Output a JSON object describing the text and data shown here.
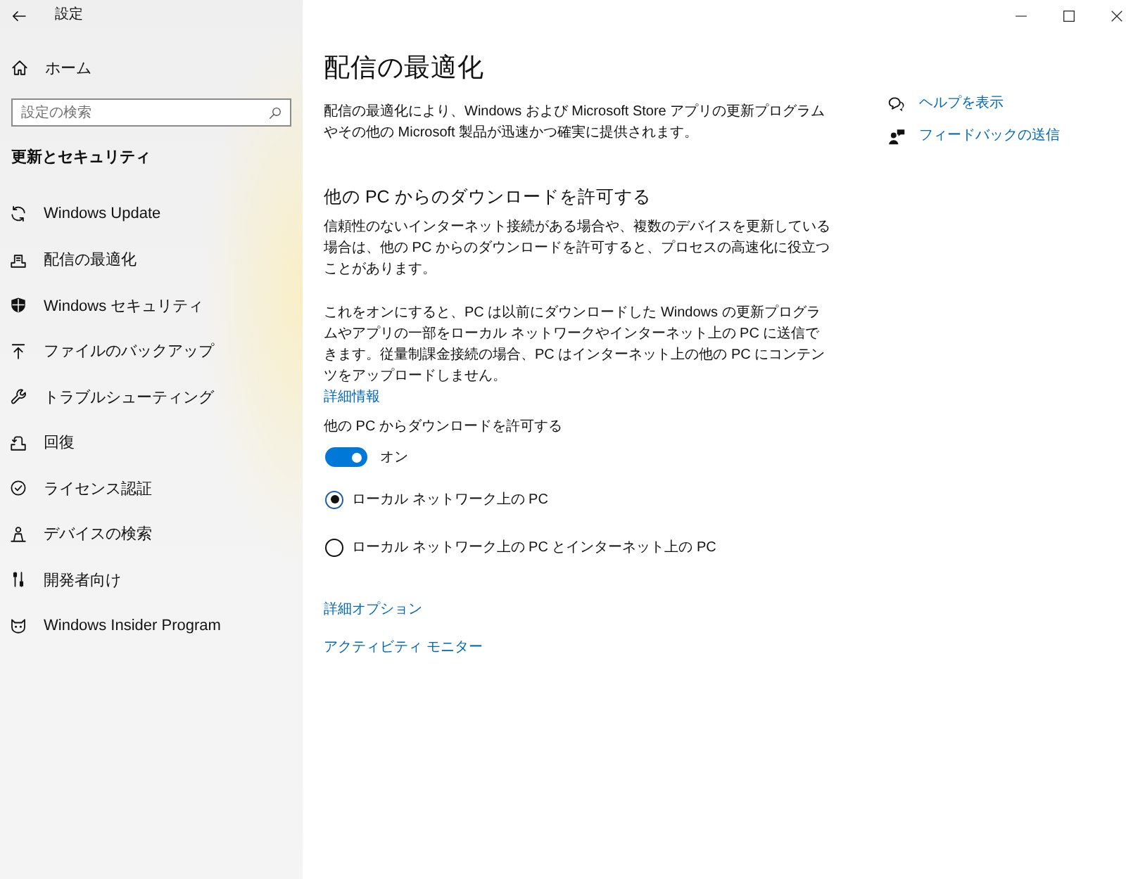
{
  "window": {
    "title": "設定"
  },
  "sidebar": {
    "home": "ホーム",
    "search": {
      "placeholder": "設定の検索"
    },
    "section": "更新とセキュリティ",
    "items": [
      "Windows Update",
      "配信の最適化",
      "Windows セキュリティ",
      "ファイルのバックアップ",
      "トラブルシューティング",
      "回復",
      "ライセンス認証",
      "デバイスの検索",
      "開発者向け",
      "Windows Insider Program"
    ]
  },
  "content": {
    "title": "配信の最適化",
    "intro": "配信の最適化により、Windows および Microsoft Store アプリの更新プログラムやその他の Microsoft 製品が迅速かつ確実に提供されます。",
    "section_title": "他の PC からのダウンロードを許可する",
    "paragraphs": [
      "信頼性のないインターネット接続がある場合や、複数のデバイスを更新している場合は、他の PC からのダウンロードを許可すると、プロセスの高速化に役立つことがあります。",
      "これをオンにすると、PC は以前にダウンロードした Windows の更新プログラムやアプリの一部をローカル ネットワークやインターネット上の PC に送信できます。従量制課金接続の場合、PC はインターネット上の他の PC にコンテンツをアップロードしません。"
    ],
    "learn_more": "詳細情報",
    "toggle": {
      "label": "他の PC からダウンロードを許可する",
      "on": true,
      "state_text": "オン"
    },
    "options": [
      {
        "label": "ローカル ネットワーク上の PC",
        "selected": true
      },
      {
        "label": "ローカル ネットワーク上の PC とインターネット上の PC",
        "selected": false
      }
    ],
    "links": [
      "詳細オプション",
      "アクティビティ モニター"
    ]
  },
  "related": {
    "links": [
      "ヘルプを表示",
      "フィードバックの送信"
    ]
  }
}
